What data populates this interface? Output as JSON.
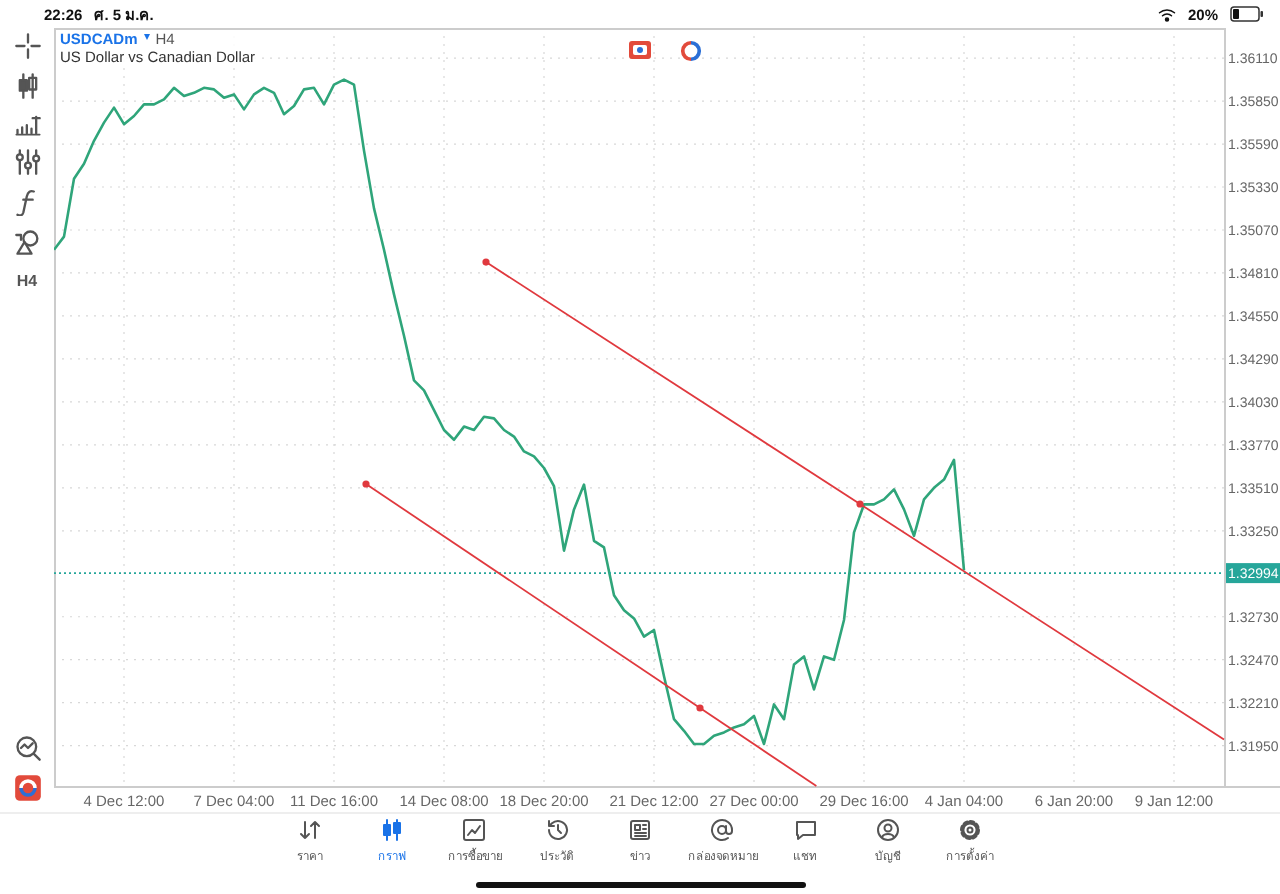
{
  "status_bar": {
    "time": "22:26",
    "date": "ศ. 5 ม.ค.",
    "battery": "20%"
  },
  "left_toolbar": {
    "timeframe": "H4"
  },
  "chart": {
    "symbol": "USDCADm",
    "caret": "▾",
    "timeframe": "H4",
    "description": "US Dollar vs Canadian Dollar",
    "current_price": "1.32994",
    "chart_data": {
      "type": "line",
      "grid": true,
      "categories": [
        null,
        null,
        null,
        null,
        null,
        null,
        null,
        "4 Dec 12:00",
        null,
        null,
        null,
        null,
        null,
        null,
        null,
        null,
        null,
        null,
        "7 Dec 04:00",
        null,
        null,
        null,
        null,
        null,
        null,
        null,
        null,
        null,
        "11 Dec 16:00",
        null,
        null,
        null,
        null,
        null,
        null,
        null,
        null,
        null,
        null,
        "14 Dec 08:00",
        null,
        null,
        null,
        null,
        null,
        null,
        null,
        null,
        null,
        "18 Dec 20:00",
        null,
        null,
        null,
        null,
        null,
        null,
        null,
        null,
        null,
        null,
        "21 Dec 12:00",
        null,
        null,
        null,
        null,
        null,
        null,
        null,
        null,
        null,
        "27 Dec 00:00",
        null,
        null,
        null,
        null,
        null,
        null,
        null,
        null,
        null,
        null,
        "29 Dec 16:00",
        null,
        null,
        null,
        null,
        null,
        null,
        null,
        null,
        null,
        "4 Jan 04:00",
        null,
        null,
        null,
        null,
        null,
        null,
        null,
        null,
        null,
        null,
        "6 Jan 20:00",
        null,
        null,
        null,
        null,
        null,
        null,
        null,
        null,
        null,
        "9 Jan 12:00",
        null,
        null,
        null,
        null,
        null
      ],
      "series": [
        {
          "color": "#2fa57a",
          "values": [
            1.3495,
            1.3503,
            1.3538,
            1.3547,
            1.3561,
            1.3572,
            1.3581,
            1.3571,
            1.3576,
            1.3583,
            1.3583,
            1.3586,
            1.3593,
            1.3588,
            1.359,
            1.3593,
            1.3592,
            1.3587,
            1.3589,
            1.358,
            1.3589,
            1.3593,
            1.359,
            1.3577,
            1.3582,
            1.3592,
            1.3593,
            1.3583,
            1.3595,
            1.3598,
            1.3595,
            1.3555,
            1.352,
            1.3495,
            1.3468,
            1.3443,
            1.3416,
            1.341,
            1.3398,
            1.3386,
            1.338,
            1.3388,
            1.3386,
            1.3394,
            1.3393,
            1.3386,
            1.3382,
            1.3373,
            1.337,
            1.3363,
            1.3352,
            1.3313,
            1.3338,
            1.3353,
            1.3319,
            1.3315,
            1.3286,
            1.3277,
            1.3272,
            1.3261,
            1.3265,
            1.3237,
            1.3211,
            1.3204,
            1.3196,
            1.3196,
            1.3201,
            1.3203,
            1.3206,
            1.3208,
            1.3213,
            1.3196,
            1.322,
            1.3211,
            1.3244,
            1.3249,
            1.3229,
            1.3249,
            1.3247,
            1.3271,
            1.3324,
            1.3341,
            1.3341,
            1.3344,
            1.335,
            1.3338,
            1.3322,
            1.3344,
            1.3351,
            1.3356,
            1.3368,
            1.3301,
            null,
            null,
            null,
            null,
            null,
            null,
            null,
            null,
            null,
            null,
            null,
            null,
            null,
            null,
            null,
            null,
            null,
            null,
            null,
            null,
            null,
            null,
            null,
            null,
            null,
            null
          ]
        }
      ],
      "ylim": [
        1.31706,
        1.36292
      ],
      "yticks": [
        {
          "value": 1.3611,
          "label": "1.36110"
        },
        {
          "value": 1.3585,
          "label": "1.35850"
        },
        {
          "value": 1.3559,
          "label": "1.35590"
        },
        {
          "value": 1.3533,
          "label": "1.35330"
        },
        {
          "value": 1.3507,
          "label": "1.35070"
        },
        {
          "value": 1.3481,
          "label": "1.34810"
        },
        {
          "value": 1.3455,
          "label": "1.34550"
        },
        {
          "value": 1.3429,
          "label": "1.34290"
        },
        {
          "value": 1.3403,
          "label": "1.34030"
        },
        {
          "value": 1.3377,
          "label": "1.33770"
        },
        {
          "value": 1.3351,
          "label": "1.33510"
        },
        {
          "value": 1.3325,
          "label": "1.33250"
        },
        {
          "value": 1.3273,
          "label": "1.32730"
        },
        {
          "value": 1.3247,
          "label": "1.32470"
        },
        {
          "value": 1.3221,
          "label": "1.32210"
        },
        {
          "value": 1.3195,
          "label": "1.31950"
        }
      ]
    }
  },
  "bottom_nav": {
    "items": [
      {
        "label": "ราคา",
        "selected": false
      },
      {
        "label": "กราฟ",
        "selected": true
      },
      {
        "label": "การซื้อขาย",
        "selected": false
      },
      {
        "label": "ประวัติ",
        "selected": false
      },
      {
        "label": "ข่าว",
        "selected": false
      },
      {
        "label": "กล่องจดหมาย",
        "selected": false
      },
      {
        "label": "แชท",
        "selected": false
      },
      {
        "label": "บัญชี",
        "selected": false
      },
      {
        "label": "การตั้งค่า",
        "selected": false
      }
    ]
  }
}
